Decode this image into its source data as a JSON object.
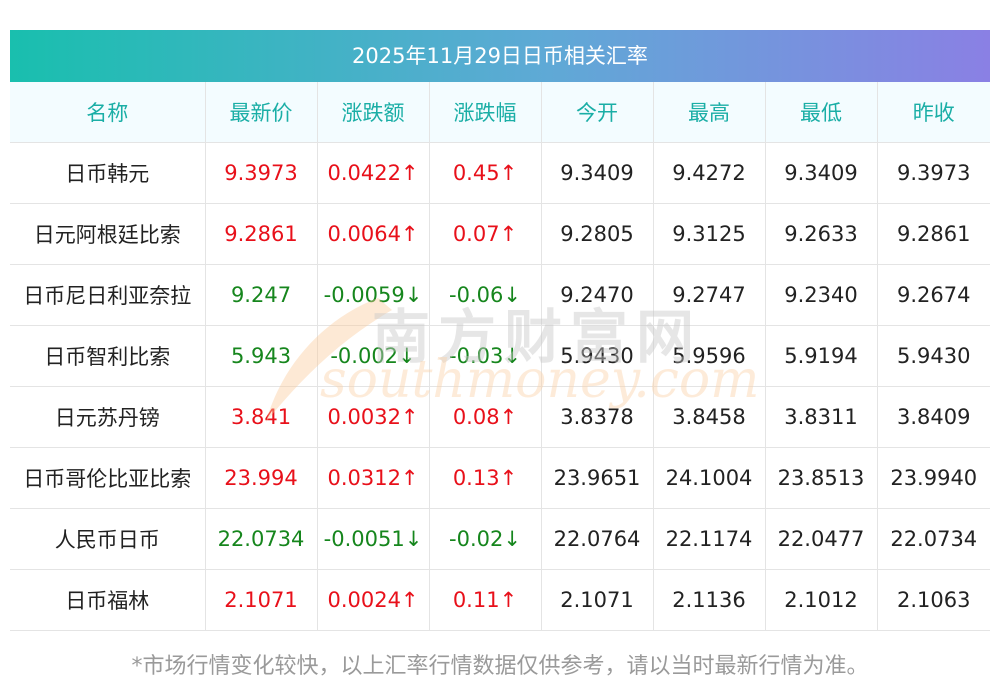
{
  "title": "2025年11月29日日币相关汇率",
  "columns": [
    "名称",
    "最新价",
    "涨跌额",
    "涨跌幅",
    "今开",
    "最高",
    "最低",
    "昨收"
  ],
  "rows": [
    {
      "name": "日币韩元",
      "latest": "9.3973",
      "change": "0.0422↑",
      "change_pct": "0.45↑",
      "open": "9.3409",
      "high": "9.4272",
      "low": "9.3409",
      "prev_close": "9.3973",
      "direction": "up"
    },
    {
      "name": "日元阿根廷比索",
      "latest": "9.2861",
      "change": "0.0064↑",
      "change_pct": "0.07↑",
      "open": "9.2805",
      "high": "9.3125",
      "low": "9.2633",
      "prev_close": "9.2861",
      "direction": "up"
    },
    {
      "name": "日币尼日利亚奈拉",
      "latest": "9.247",
      "change": "-0.0059↓",
      "change_pct": "-0.06↓",
      "open": "9.2470",
      "high": "9.2747",
      "low": "9.2340",
      "prev_close": "9.2674",
      "direction": "down"
    },
    {
      "name": "日币智利比索",
      "latest": "5.943",
      "change": "-0.002↓",
      "change_pct": "-0.03↓",
      "open": "5.9430",
      "high": "5.9596",
      "low": "5.9194",
      "prev_close": "5.9430",
      "direction": "down"
    },
    {
      "name": "日元苏丹镑",
      "latest": "3.841",
      "change": "0.0032↑",
      "change_pct": "0.08↑",
      "open": "3.8378",
      "high": "3.8458",
      "low": "3.8311",
      "prev_close": "3.8409",
      "direction": "up"
    },
    {
      "name": "日币哥伦比亚比索",
      "latest": "23.994",
      "change": "0.0312↑",
      "change_pct": "0.13↑",
      "open": "23.9651",
      "high": "24.1004",
      "low": "23.8513",
      "prev_close": "23.9940",
      "direction": "up"
    },
    {
      "name": "人民币日币",
      "latest": "22.0734",
      "change": "-0.0051↓",
      "change_pct": "-0.02↓",
      "open": "22.0764",
      "high": "22.1174",
      "low": "22.0477",
      "prev_close": "22.0734",
      "direction": "down"
    },
    {
      "name": "日币福林",
      "latest": "2.1071",
      "change": "0.0024↑",
      "change_pct": "0.11↑",
      "open": "2.1071",
      "high": "2.1136",
      "low": "2.1012",
      "prev_close": "2.1063",
      "direction": "up"
    }
  ],
  "watermark": {
    "cn": "南方财富网",
    "en": "southmoney.com"
  },
  "footnote": "*市场行情变化较快，以上汇率行情数据仅供参考，请以当时最新行情为准。",
  "colors": {
    "up": "#e8101a",
    "down": "#16861d",
    "header_text": "#1aaea6",
    "title_gradient_start": "#19bfae",
    "title_gradient_end": "#8a80e4"
  }
}
